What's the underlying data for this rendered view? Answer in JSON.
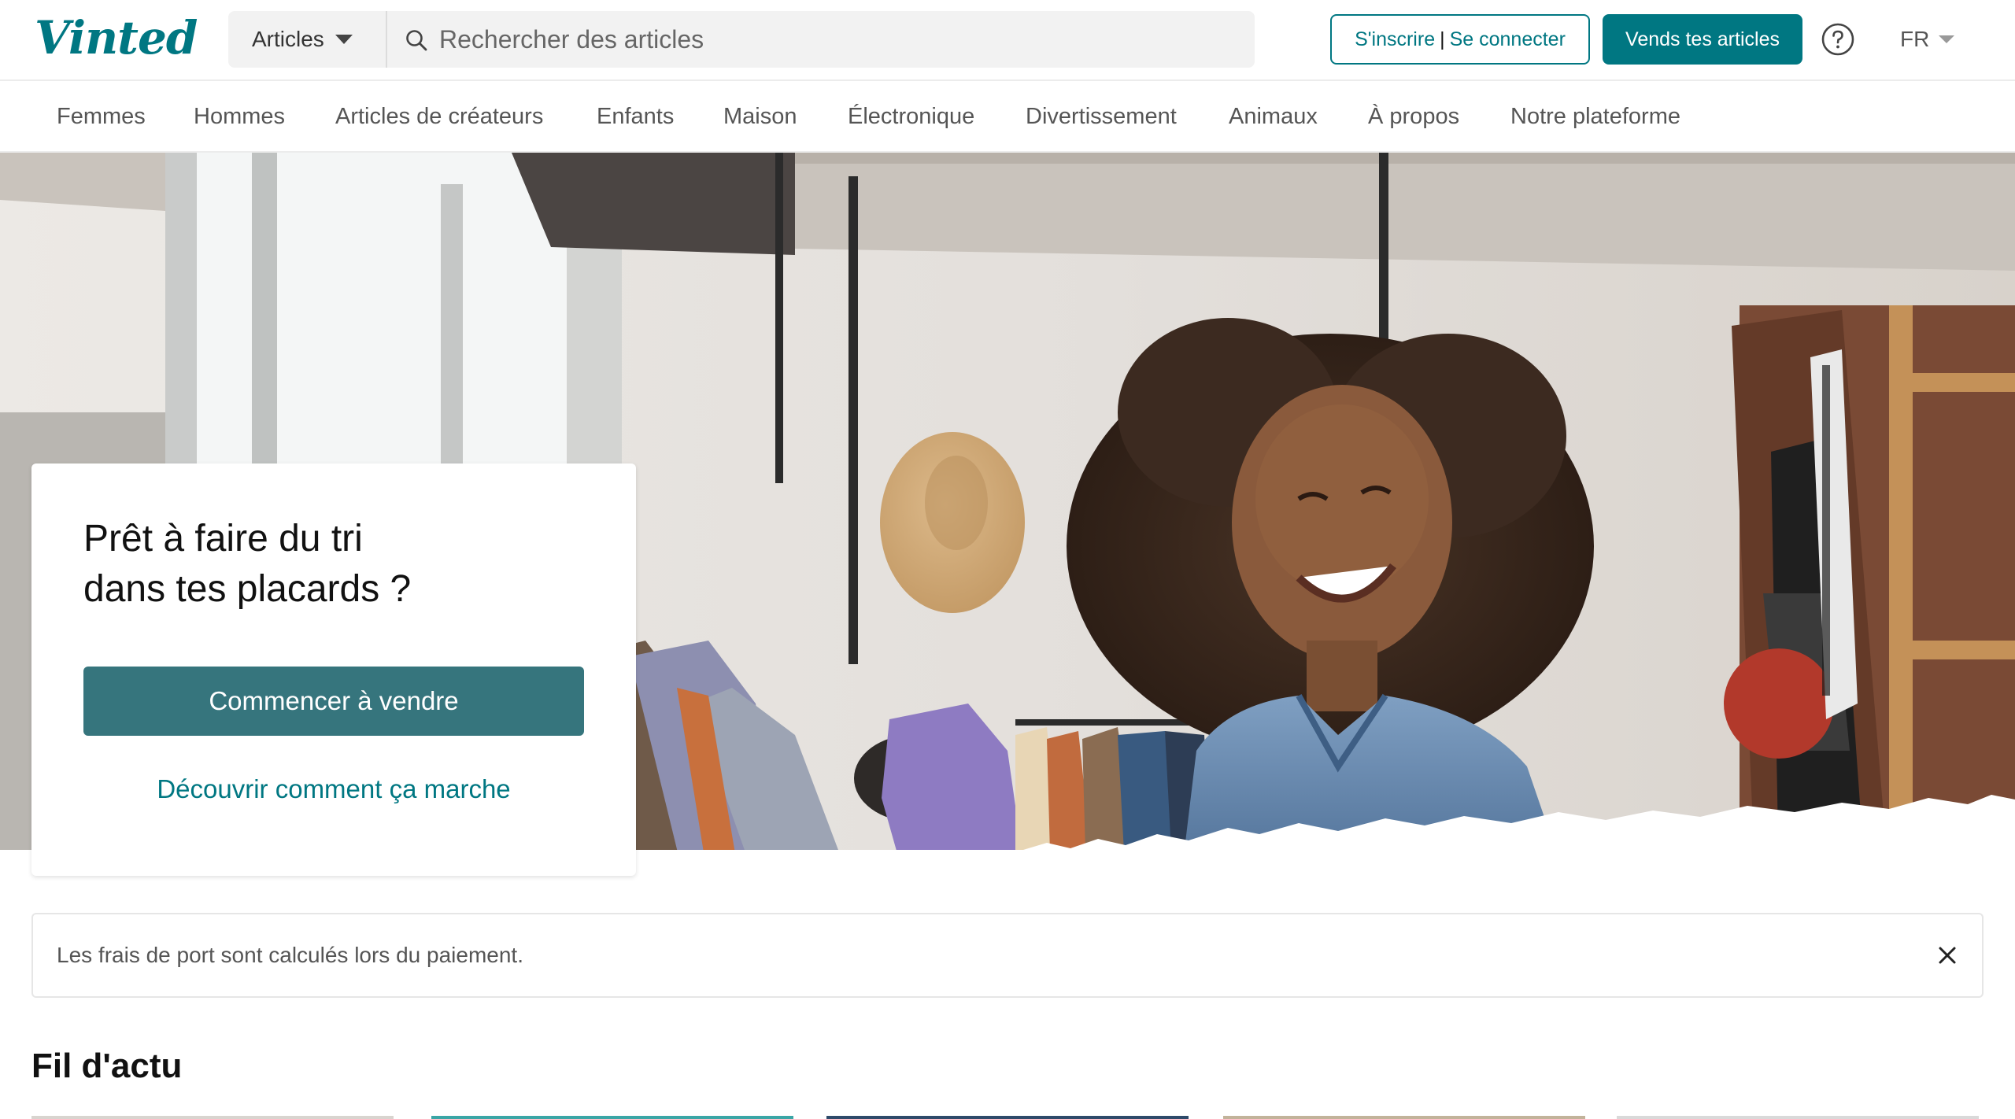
{
  "header": {
    "logo": "Vinted",
    "category_select": "Articles",
    "search_placeholder": "Rechercher des articles",
    "login": {
      "signup": "S'inscrire",
      "separator": "|",
      "signin": "Se connecter"
    },
    "sell_button": "Vends tes articles",
    "language": "FR",
    "icons": {
      "search": "search-icon",
      "help": "help-circle-icon",
      "dropdown": "chevron-down-icon"
    }
  },
  "nav": {
    "items": [
      {
        "label": "Femmes"
      },
      {
        "label": "Hommes"
      },
      {
        "label": "Articles de créateurs"
      },
      {
        "label": "Enfants"
      },
      {
        "label": "Maison"
      },
      {
        "label": "Électronique"
      },
      {
        "label": "Divertissement"
      },
      {
        "label": "Animaux"
      },
      {
        "label": "À propos"
      },
      {
        "label": "Notre plateforme"
      }
    ]
  },
  "hero": {
    "title_line1": "Prêt à faire du tri",
    "title_line2": "dans tes placards ?",
    "cta_button": "Commencer à vendre",
    "how_it_works_link": "Découvrir comment ça marche"
  },
  "banner": {
    "text": "Les frais de port sont calculés lors du paiement.",
    "close_icon": "close-icon"
  },
  "feed": {
    "title": "Fil d'actu"
  },
  "colors": {
    "brand": "#007782",
    "cta": "#36757d",
    "text": "#111111",
    "muted": "#555555"
  }
}
